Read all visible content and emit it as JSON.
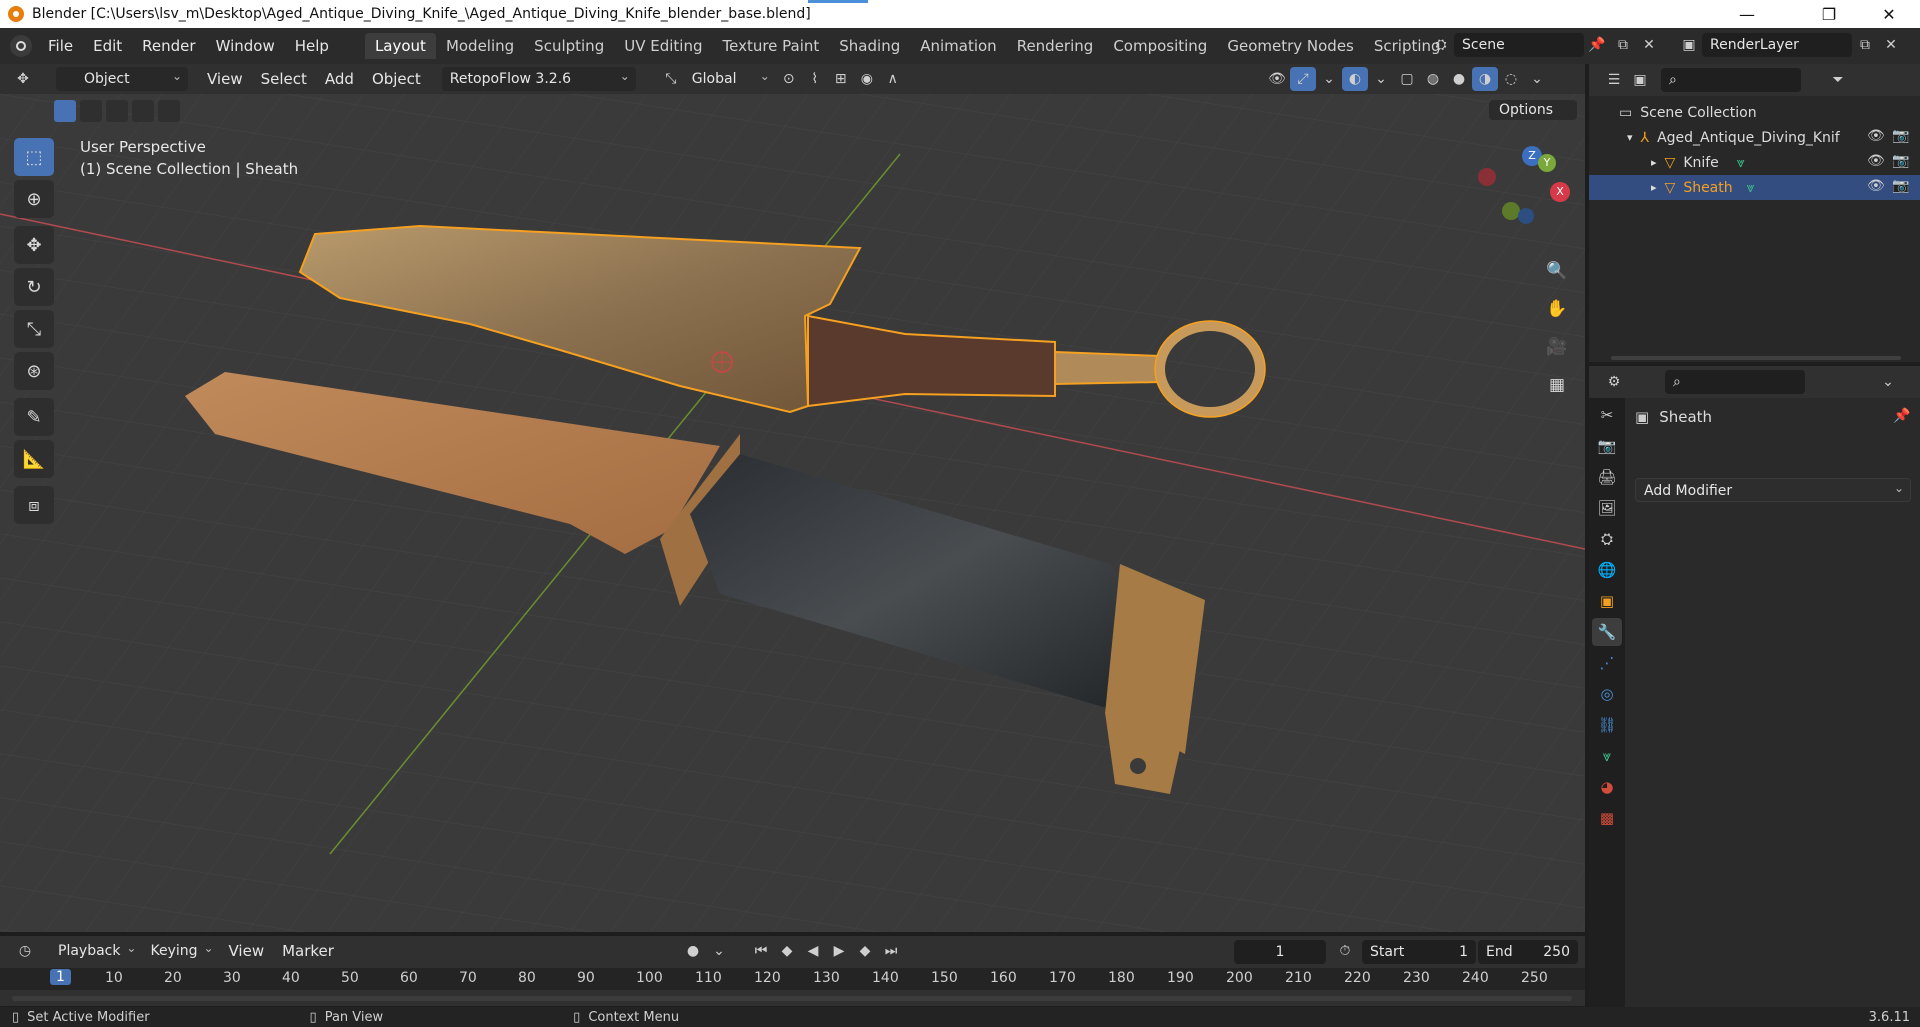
{
  "window": {
    "title": "Blender [C:\\Users\\lsv_m\\Desktop\\Aged_Antique_Diving_Knife_\\Aged_Antique_Diving_Knife_blender_base.blend]",
    "minimize": "—",
    "maximize": "❐",
    "close": "✕"
  },
  "menu": [
    "File",
    "Edit",
    "Render",
    "Window",
    "Help"
  ],
  "workspaces": [
    "Layout",
    "Modeling",
    "Sculpting",
    "UV Editing",
    "Texture Paint",
    "Shading",
    "Animation",
    "Rendering",
    "Compositing",
    "Geometry Nodes",
    "Scripting"
  ],
  "active_workspace": "Layout",
  "add_workspace": "+",
  "scene": {
    "name": "Scene",
    "render_layer": "RenderLayer"
  },
  "viewport_header": {
    "mode": "Object Mode",
    "menus": [
      "View",
      "Select",
      "Add",
      "Object"
    ],
    "addon": "RetopoFlow 3.2.6 (github)",
    "transform_orientation": "Global"
  },
  "viewport": {
    "perspective": "User Perspective",
    "collection_info": "(1) Scene Collection | Sheath",
    "options": "Options",
    "gizmo": {
      "x": "X",
      "y": "Y",
      "z": "Z"
    }
  },
  "outliner": {
    "search_placeholder": "",
    "scene_collection": "Scene Collection",
    "items": [
      {
        "label": "Aged_Antique_Diving_Knif"
      },
      {
        "label": "Knife"
      },
      {
        "label": "Sheath"
      }
    ]
  },
  "properties": {
    "object_name": "Sheath",
    "add_modifier": "Add Modifier"
  },
  "timeline": {
    "menus": [
      "Playback",
      "Keying",
      "View",
      "Marker"
    ],
    "current_frame": "1",
    "start_label": "Start",
    "start": "1",
    "end_label": "End",
    "end": "250",
    "ticks": [
      "1",
      "10",
      "20",
      "30",
      "40",
      "50",
      "60",
      "70",
      "80",
      "90",
      "100",
      "110",
      "120",
      "130",
      "140",
      "150",
      "160",
      "170",
      "180",
      "190",
      "200",
      "210",
      "220",
      "230",
      "240",
      "250"
    ]
  },
  "statusbar": {
    "left": "Set Active Modifier",
    "middle": "Pan View",
    "right": "Context Menu",
    "version": "3.6.11"
  },
  "colors": {
    "accent": "#4772b3",
    "selected_outline": "#f5a020",
    "active_text": "#f5a020",
    "x_axis": "#d63a48",
    "y_axis": "#8cbe3c",
    "z_axis": "#4a8fd8"
  }
}
